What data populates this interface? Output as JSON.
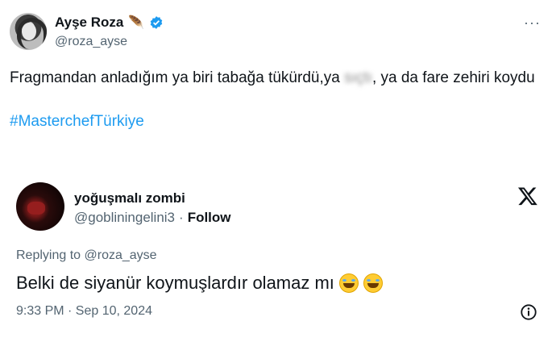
{
  "quoted_tweet": {
    "author_name": "Ayşe Roza",
    "name_emoji": "🪶",
    "handle": "@roza_ayse",
    "more_icon": "···",
    "text_before": "Fragmandan anladığım ya biri tabağa tükürdü,ya",
    "text_blurred": "sıçtı",
    "text_after": ", ya da fare zehiri koydu",
    "hashtag": "#MasterchefTürkiye"
  },
  "reply_tweet": {
    "author_name": "yoğuşmalı zombi",
    "handle": "@gobliningelini3",
    "separator": "·",
    "follow_label": "Follow",
    "replying_to": "Replying to @roza_ayse",
    "text": "Belki de siyanür koymuşlardır olamaz mı",
    "timestamp": "9:33 PM · Sep 10, 2024"
  },
  "colors": {
    "link": "#1d9bf0",
    "secondary_text": "#536471",
    "primary_text": "#0f1419"
  },
  "icons": {
    "verified": "verified-badge-icon",
    "x_logo": "x-logo-icon",
    "info": "info-icon",
    "emoji": "rolling-on-floor-laughing-emoji"
  }
}
